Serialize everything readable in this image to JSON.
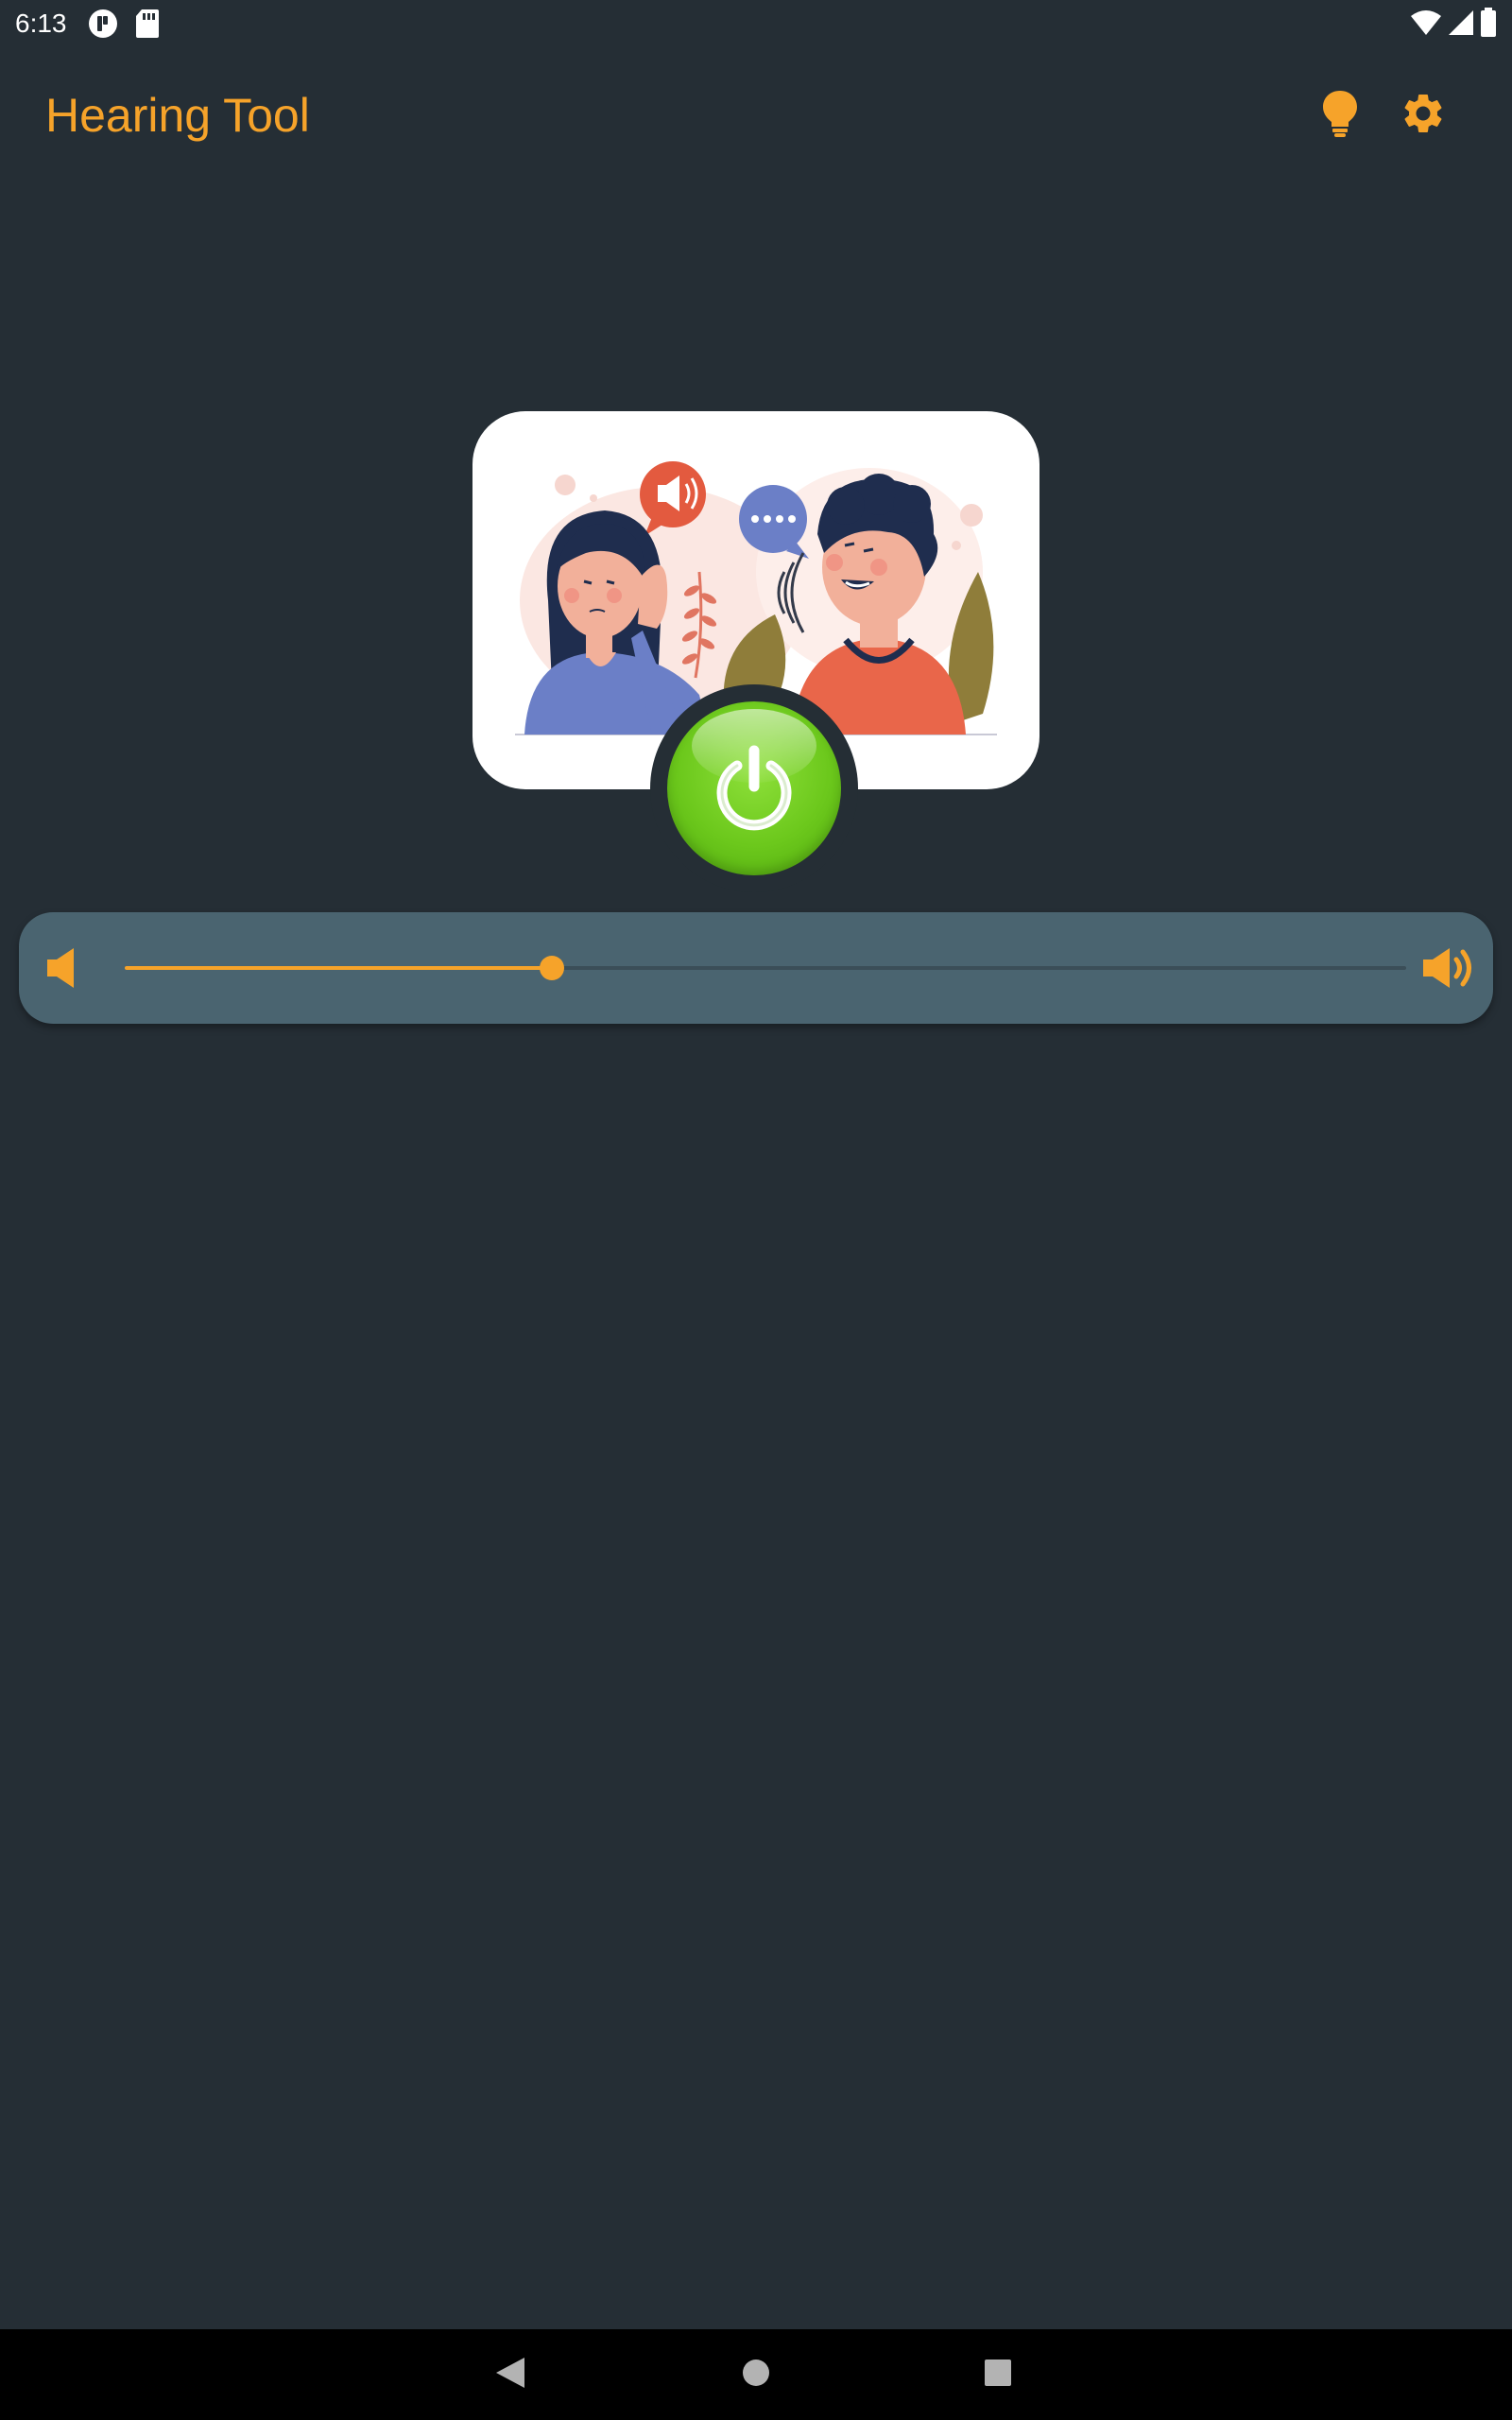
{
  "status_bar": {
    "time": "6:13",
    "icons_left": [
      "notification-app-icon",
      "sd-card-icon"
    ],
    "icons_right": [
      "wifi-icon",
      "cell-signal-icon",
      "battery-icon"
    ]
  },
  "app_bar": {
    "title": "Hearing Tool",
    "actions": [
      "lightbulb-icon",
      "gear-icon"
    ]
  },
  "illustration": {
    "subject": "hearing-illustration"
  },
  "power_button": {
    "state": "on",
    "icon": "power-icon"
  },
  "volume": {
    "level": 0.333,
    "min_icon": "volume-low-icon",
    "max_icon": "volume-high-icon"
  },
  "nav_bar": {
    "buttons": [
      "back-icon",
      "home-icon",
      "recents-icon"
    ]
  },
  "colors": {
    "background": "#252e35",
    "accent": "#f6a32a",
    "panel": "#4a6470",
    "power_green": "#6cc81c",
    "nav": "#000000"
  }
}
